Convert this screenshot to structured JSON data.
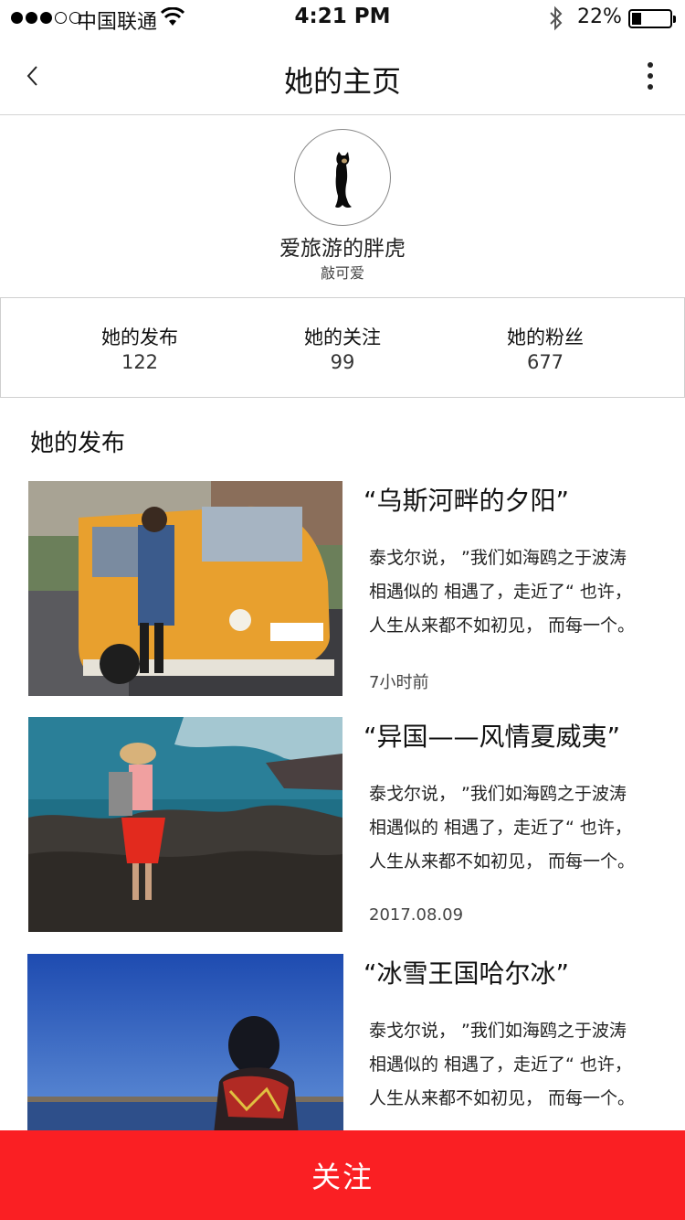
{
  "status_bar": {
    "carrier": "中国联通",
    "time": "4:21 PM",
    "battery": "22%"
  },
  "nav": {
    "title": "她的主页",
    "back_icon": "chevron-left-icon",
    "more_icon": "more-vertical-icon"
  },
  "profile": {
    "username": "爱旅游的胖虎",
    "bio": "敲可爱"
  },
  "stats": [
    {
      "label": "她的发布",
      "value": "122"
    },
    {
      "label": "她的关注",
      "value": "99"
    },
    {
      "label": "她的粉丝",
      "value": "677"
    }
  ],
  "section": {
    "title": "她的发布"
  },
  "posts": [
    {
      "title": "“乌斯河畔的夕阳”",
      "lines": [
        "泰戈尔说， ”我们如海鸥之于波涛",
        "相遇似的 相遇了，走近了“ 也许，",
        "人生从来都不如初见， 而每一个。"
      ],
      "time": "7小时前"
    },
    {
      "title": "“异国——风情夏威夷”",
      "lines": [
        "泰戈尔说， ”我们如海鸥之于波涛",
        "相遇似的 相遇了，走近了“ 也许，",
        "人生从来都不如初见， 而每一个。"
      ],
      "time": "2017.08.09"
    },
    {
      "title": "“冰雪王国哈尔冰”",
      "lines": [
        "泰戈尔说， ”我们如海鸥之于波涛",
        "相遇似的 相遇了，走近了“ 也许，",
        "人生从来都不如初见， 而每一个。"
      ],
      "time": ""
    }
  ],
  "follow_button": "关注",
  "colors": {
    "accent": "#fa1f23",
    "divider": "#d4d4d4"
  }
}
